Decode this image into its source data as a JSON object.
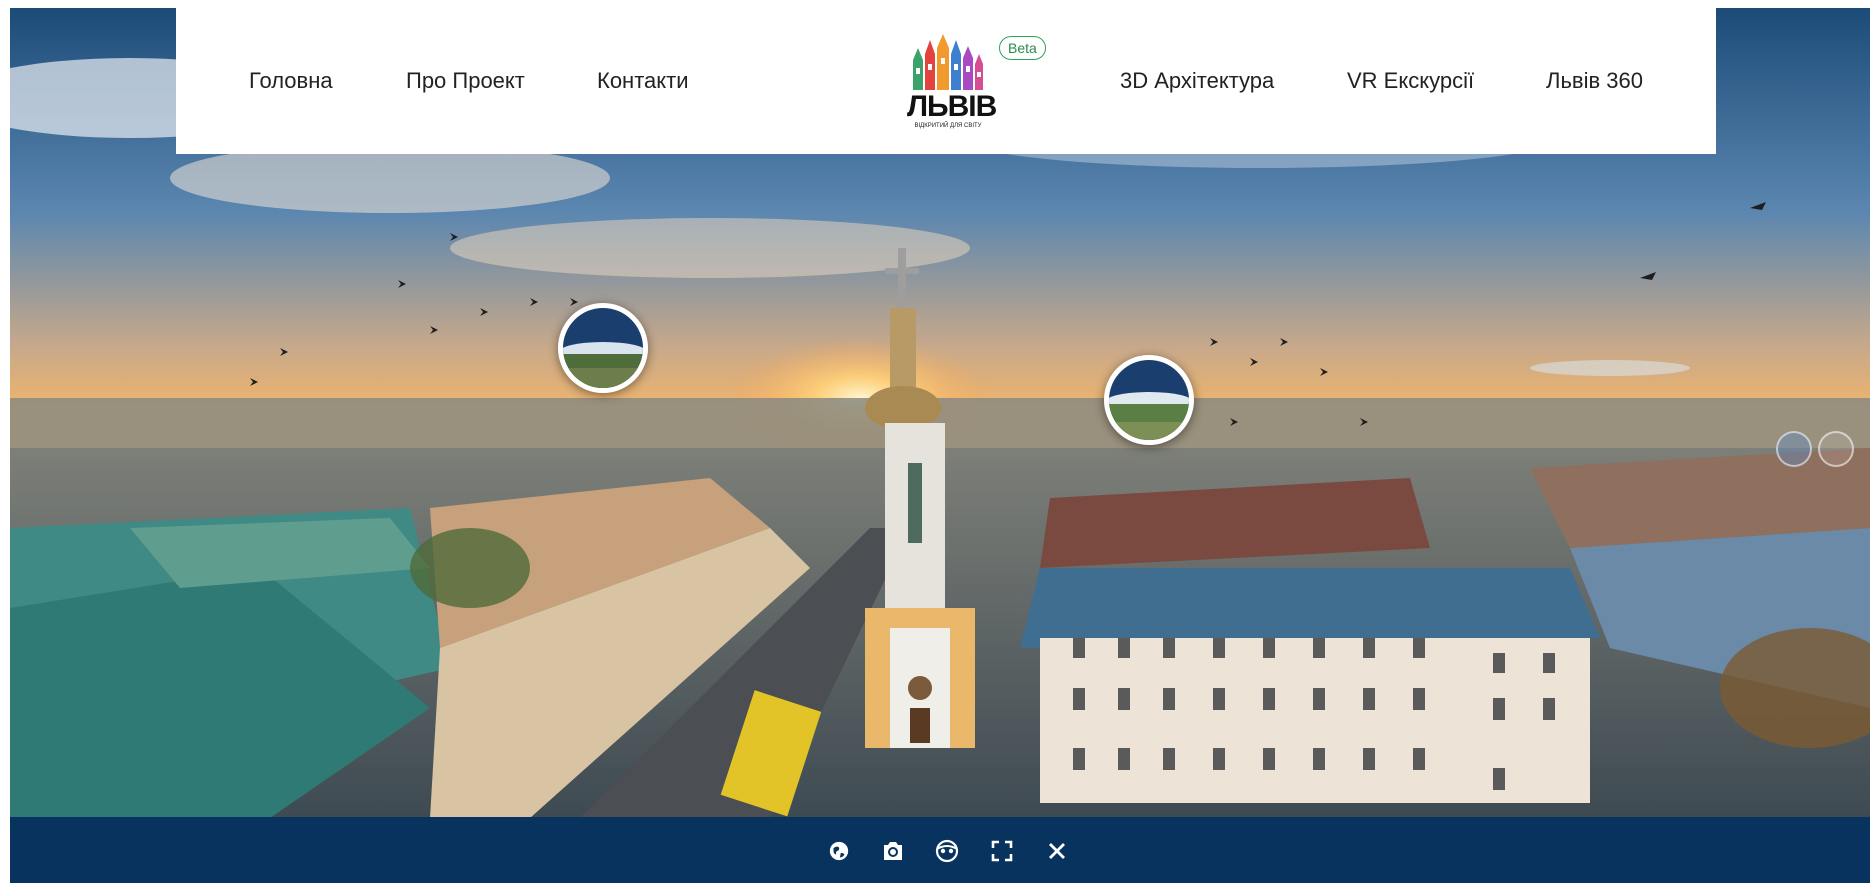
{
  "nav": {
    "left": [
      "Головна",
      "Про Проект",
      "Контакти"
    ],
    "right": [
      "3D Архітектура",
      "VR Екскурсії",
      "Львів 360"
    ]
  },
  "logo": {
    "title": "ЛЬВІВ",
    "tagline": "ВІДКРИТИЙ ДЛЯ СВІТУ"
  },
  "badge": "Beta",
  "hotspots": [
    {
      "icon": "aerial-preview-thumbnail"
    },
    {
      "icon": "aerial-preview-thumbnail"
    }
  ],
  "toolbar": {
    "buttons": [
      "globe-icon",
      "camera-icon",
      "vr-headset-icon",
      "fullscreen-icon",
      "close-icon"
    ]
  },
  "colors": {
    "toolbar_bg": "#08335e",
    "beta_border": "#2ea25a",
    "nav_text": "#222222"
  }
}
